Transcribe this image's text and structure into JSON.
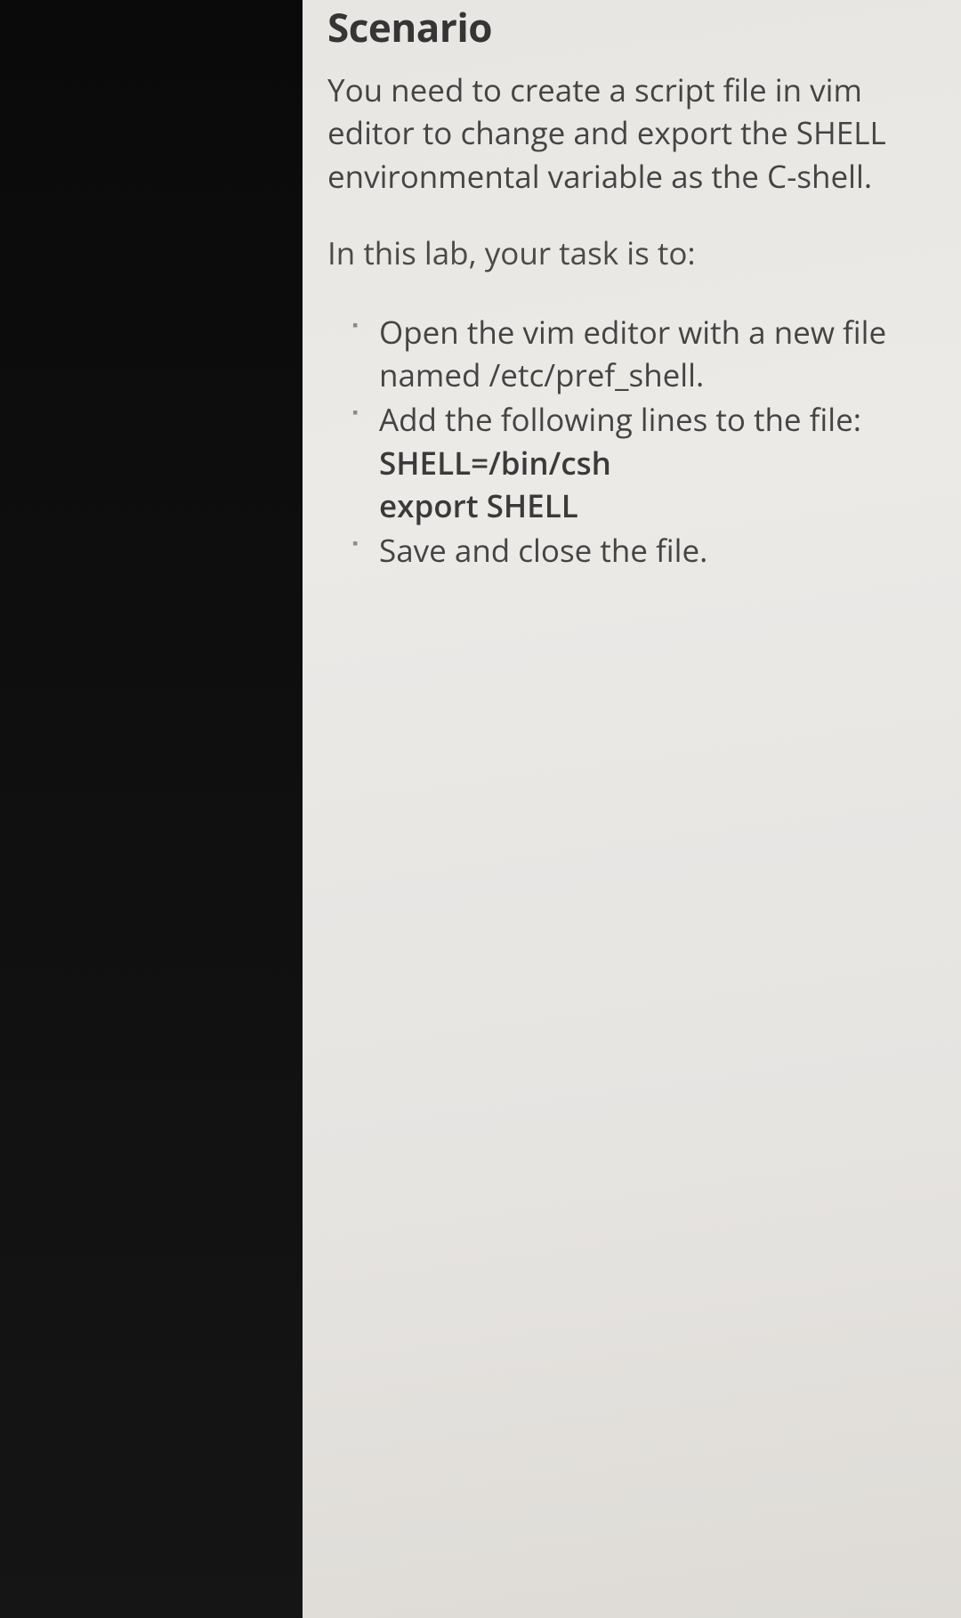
{
  "scenario": {
    "heading": "Scenario",
    "intro": "You need to create a script file in vim editor to change and export the SHELL environmental variable as the C-shell.",
    "task_intro": "In this lab, your task is to:",
    "tasks": [
      {
        "text": "Open the vim editor with a new file named /etc/pref_shell."
      },
      {
        "text": "Add the following lines to the file:",
        "line1": "SHELL=/bin/csh",
        "line2": "export SHELL"
      },
      {
        "text": "Save and close the file."
      }
    ]
  }
}
